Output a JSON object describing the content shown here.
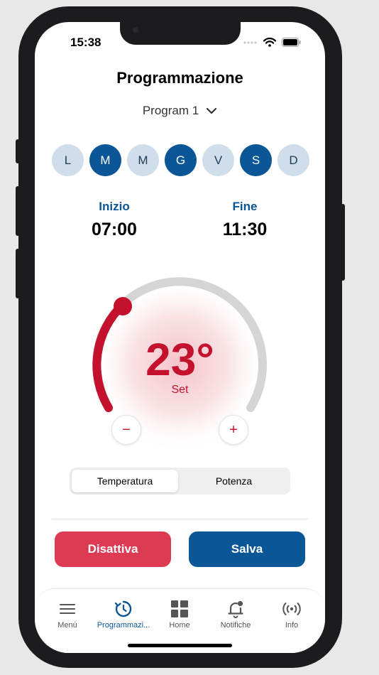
{
  "status": {
    "time": "15:38"
  },
  "header": {
    "title": "Programmazione",
    "program_label": "Program 1"
  },
  "days": [
    {
      "label": "L",
      "active": false
    },
    {
      "label": "M",
      "active": true
    },
    {
      "label": "M",
      "active": false
    },
    {
      "label": "G",
      "active": true
    },
    {
      "label": "V",
      "active": false
    },
    {
      "label": "S",
      "active": true
    },
    {
      "label": "D",
      "active": false
    }
  ],
  "schedule": {
    "start_label": "Inizio",
    "start_value": "07:00",
    "end_label": "Fine",
    "end_value": "11:30"
  },
  "thermostat": {
    "temperature": "23°",
    "set_label": "Set",
    "minus": "−",
    "plus": "+"
  },
  "mode_toggle": {
    "options": [
      "Temperatura",
      "Potenza"
    ],
    "selected": "Temperatura"
  },
  "actions": {
    "deactivate": "Disattiva",
    "save": "Salva"
  },
  "tabbar": {
    "items": [
      {
        "label": "Menù",
        "icon": "menu-icon",
        "active": false
      },
      {
        "label": "Programmazi...",
        "icon": "schedule-icon",
        "active": true
      },
      {
        "label": "Home",
        "icon": "grid-icon",
        "active": false
      },
      {
        "label": "Notifiche",
        "icon": "bell-icon",
        "active": false
      },
      {
        "label": "Info",
        "icon": "broadcast-icon",
        "active": false
      }
    ]
  },
  "colors": {
    "primary": "#0b5697",
    "danger": "#dc3b53",
    "temp_red": "#c4112e",
    "day_inactive": "#cfdeea"
  }
}
